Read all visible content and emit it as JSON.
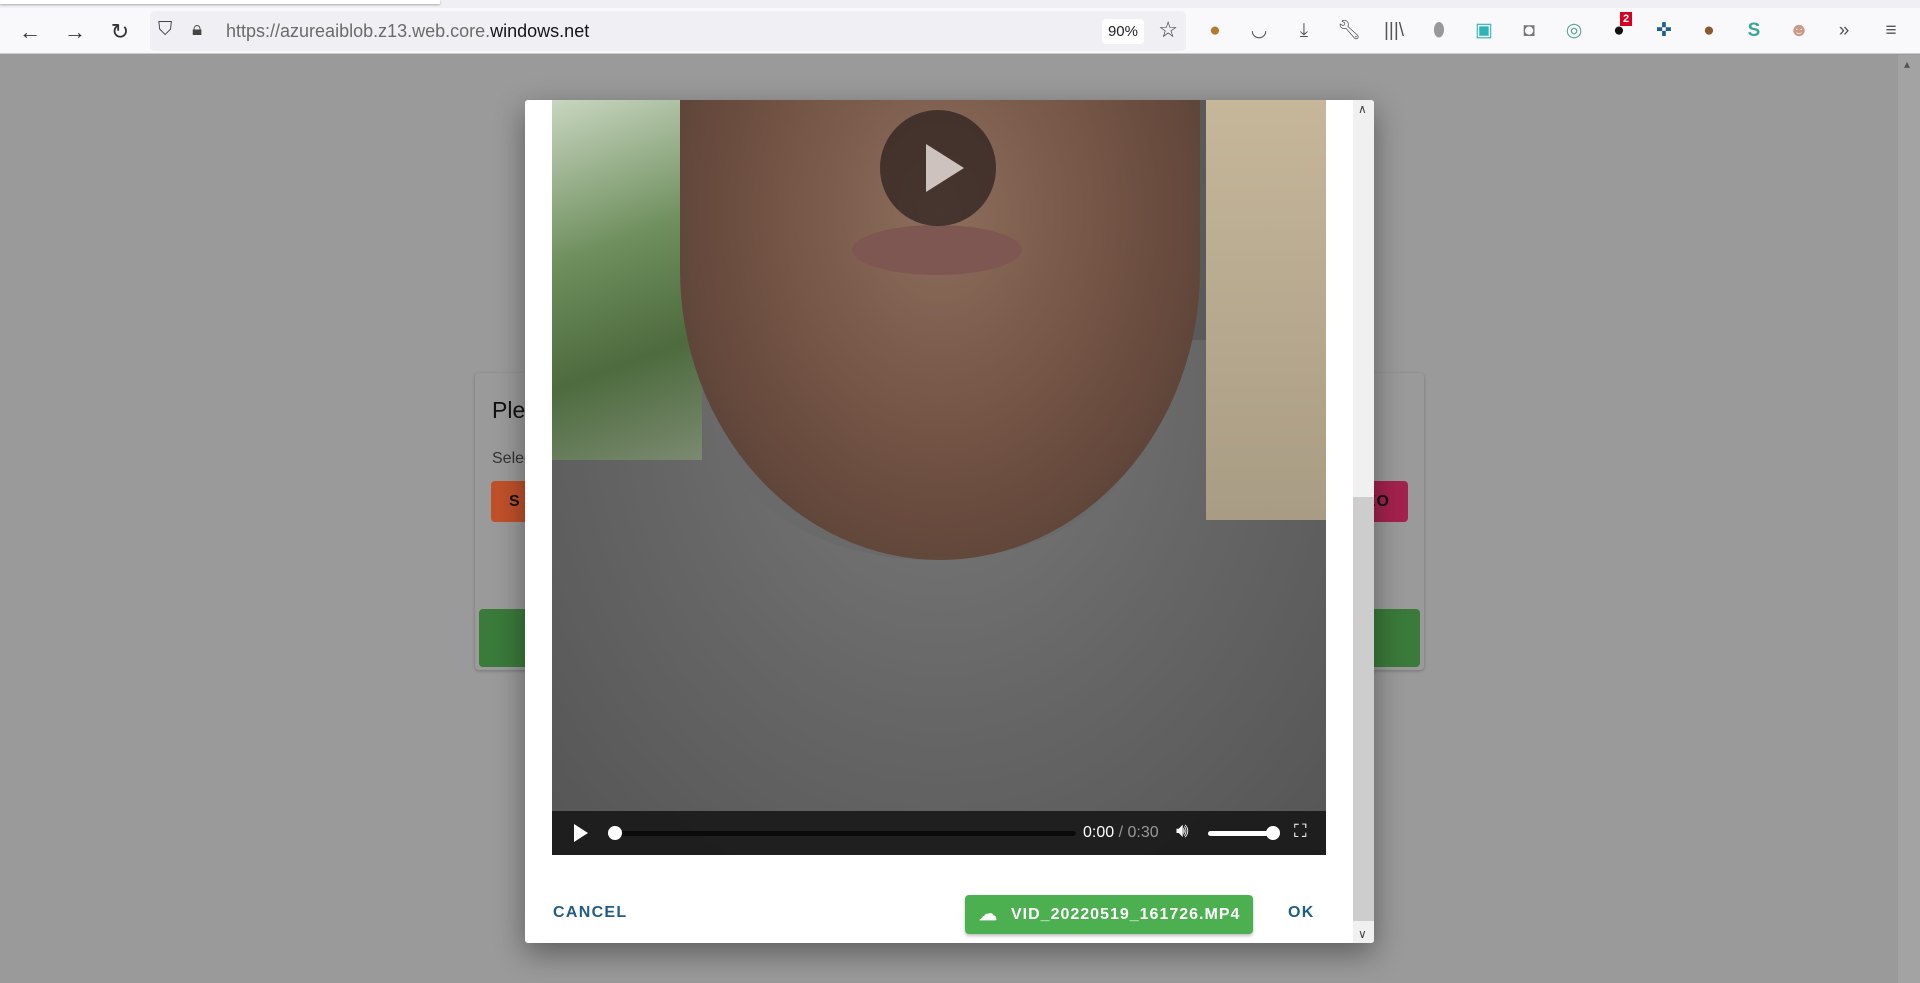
{
  "browser": {
    "url_prefix": "https://azureaiblob.z13.web.core.",
    "url_domain": "windows.net",
    "zoom": "90%",
    "extension_badge": "2",
    "icons": [
      "back-icon",
      "forward-icon",
      "reload-icon",
      "shield-icon",
      "lock-icon",
      "star-icon",
      "dog-extension-icon",
      "pocket-icon",
      "download-icon",
      "wrench-icon",
      "library-icon",
      "gray-shield-icon",
      "save-icon",
      "tab-icon",
      "circle-extension-icon",
      "bird-extension-icon",
      "cross-extension-icon",
      "cookie-icon",
      "s-extension-icon",
      "avatar-extension-icon",
      "overflow-icon",
      "menu-icon"
    ]
  },
  "background_card": {
    "title": "Ple",
    "subtitle": "Selec",
    "left_button": "S",
    "right_button": "EO",
    "colors": {
      "left_button": "#c0502a",
      "right_button": "#a3224e",
      "submit": "#3a7a3a"
    }
  },
  "dialog": {
    "video": {
      "current_time": "0:00",
      "separator": " / ",
      "duration": "0:30",
      "progress": 0,
      "volume": 1.0
    },
    "cancel_label": "CANCEL",
    "file_label": "VID_20220519_161726.MP4",
    "ok_label": "OK",
    "colors": {
      "upload": "#4caf50",
      "text_buttons": "#1f5d86"
    }
  }
}
